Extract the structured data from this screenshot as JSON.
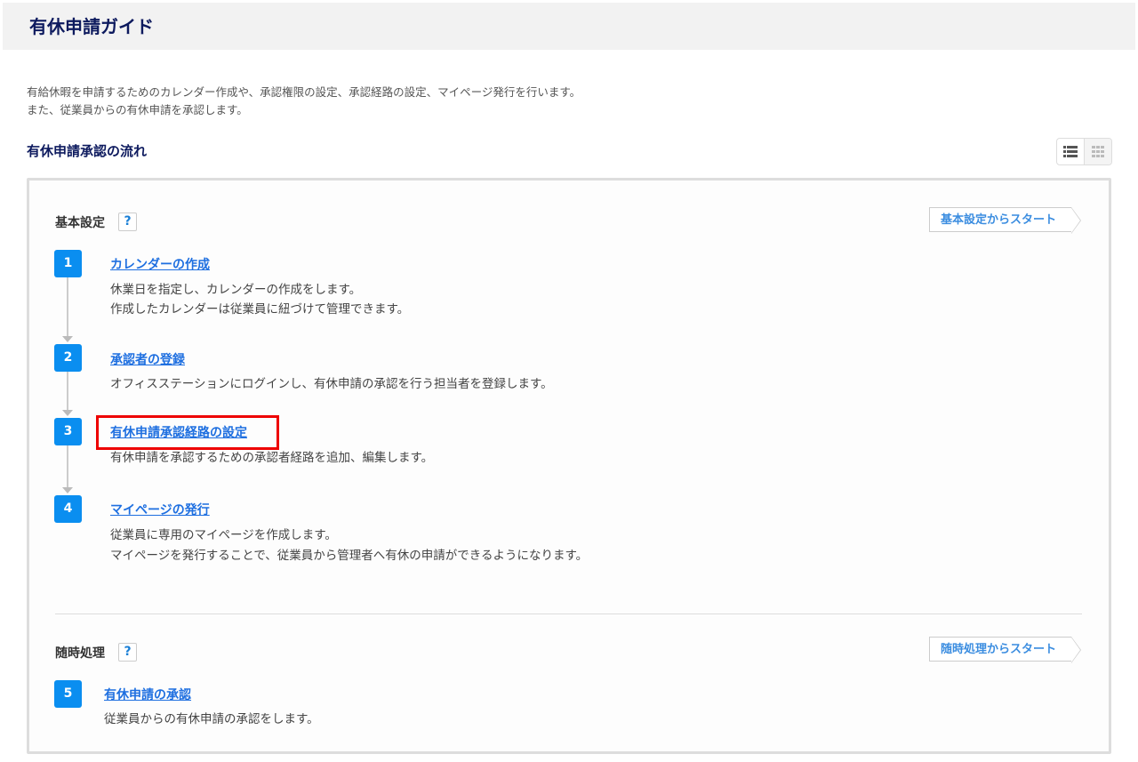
{
  "header": {
    "title": "有休申請ガイド"
  },
  "intro": [
    "有給休暇を申請するためのカレンダー作成や、承認権限の設定、承認経路の設定、マイページ発行を行います。",
    "また、従業員からの有休申請を承認します。"
  ],
  "section_title": "有休申請承認の流れ",
  "view_toggle": {
    "list_icon": "list-icon",
    "grid_icon": "grid-icon"
  },
  "groups": [
    {
      "label": "基本設定",
      "help": "?",
      "start_label": "基本設定からスタート",
      "steps": [
        {
          "num": "1",
          "title": "カレンダーの作成",
          "desc": [
            "休業日を指定し、カレンダーの作成をします。",
            "作成したカレンダーは従業員に紐づけて管理できます。"
          ]
        },
        {
          "num": "2",
          "title": "承認者の登録",
          "desc": [
            "オフィスステーションにログインし、有休申請の承認を行う担当者を登録します。"
          ]
        },
        {
          "num": "3",
          "title": "有休申請承認経路の設定",
          "desc": [
            "有休申請を承認するための承認者経路を追加、編集します。"
          ],
          "highlighted": true
        },
        {
          "num": "4",
          "title": "マイページの発行",
          "desc": [
            "従業員に専用のマイページを作成します。",
            "マイページを発行することで、従業員から管理者へ有休の申請ができるようになります。"
          ]
        }
      ]
    },
    {
      "label": "随時処理",
      "help": "?",
      "start_label": "随時処理からスタート",
      "steps": [
        {
          "num": "5",
          "title": "有休申請の承認",
          "desc": [
            "従業員からの有休申請の承認をします。"
          ]
        }
      ]
    }
  ],
  "colors": {
    "accent": "#0a8ef0",
    "navy": "#0d1a5e",
    "link": "#1e6fe0",
    "highlight": "#e00000"
  }
}
